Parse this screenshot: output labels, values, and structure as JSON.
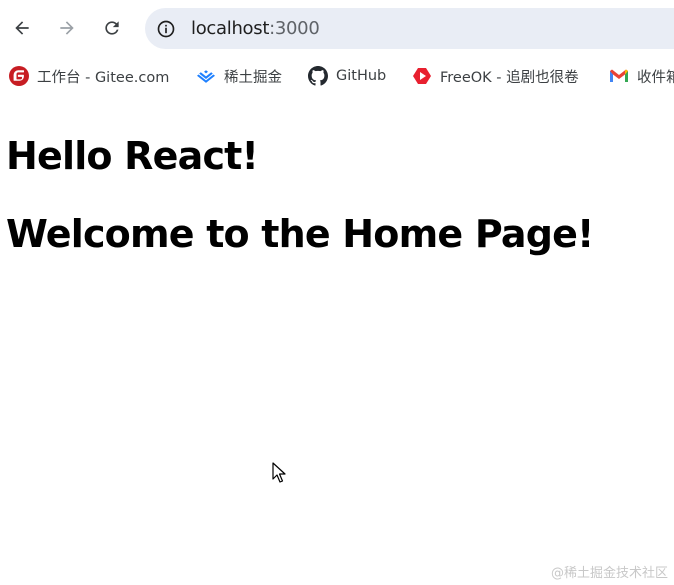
{
  "toolbar": {
    "url_host": "localhost",
    "url_port": ":3000"
  },
  "bookmarks": [
    {
      "label": "工作台 - Gitee.com",
      "icon": "gitee-icon",
      "color": "#c71d23"
    },
    {
      "label": "稀土掘金",
      "icon": "juejin-icon",
      "color": "#1e80ff"
    },
    {
      "label": "GitHub",
      "icon": "github-icon",
      "color": "#24292f"
    },
    {
      "label": "FreeOK - 追剧也很卷",
      "icon": "freeok-icon",
      "color": "#e8202f"
    },
    {
      "label": "收件箱",
      "icon": "gmail-icon",
      "color": "#ea4335"
    }
  ],
  "page": {
    "heading_1": "Hello React!",
    "heading_2": "Welcome to the Home Page!"
  },
  "watermark": "@稀土掘金技术社区"
}
